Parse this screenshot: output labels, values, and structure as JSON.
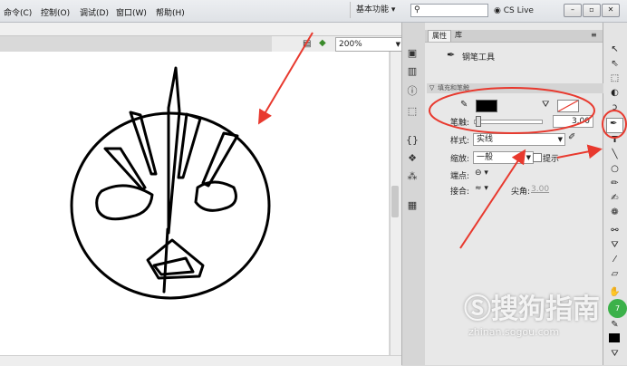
{
  "menu": {
    "items": [
      "命令(C)",
      "控制(O)",
      "调试(D)",
      "窗口(W)",
      "帮助(H)"
    ],
    "workspace": "基本功能",
    "cs_live": "CS Live"
  },
  "stage": {
    "zoom": "200%"
  },
  "panel": {
    "tab_properties": "属性",
    "tab_library": "库",
    "tool_name": "钢笔工具",
    "section_title": "填充和笔触",
    "stroke_label": "笔触:",
    "stroke_value": "3.00",
    "style_label": "样式:",
    "style_value": "实线",
    "scale_label": "缩放:",
    "scale_value": "一般",
    "hint_label": "提示",
    "cap_label": "端点:",
    "join_label": "接合:",
    "miter_label": "尖角:",
    "miter_value": "3.00"
  },
  "colors": {
    "stroke": "#000000",
    "fill": "none",
    "annotation": "#e8392e"
  },
  "watermark": {
    "brand": "搜狗指南",
    "url": "zhinan.sogou.com"
  }
}
